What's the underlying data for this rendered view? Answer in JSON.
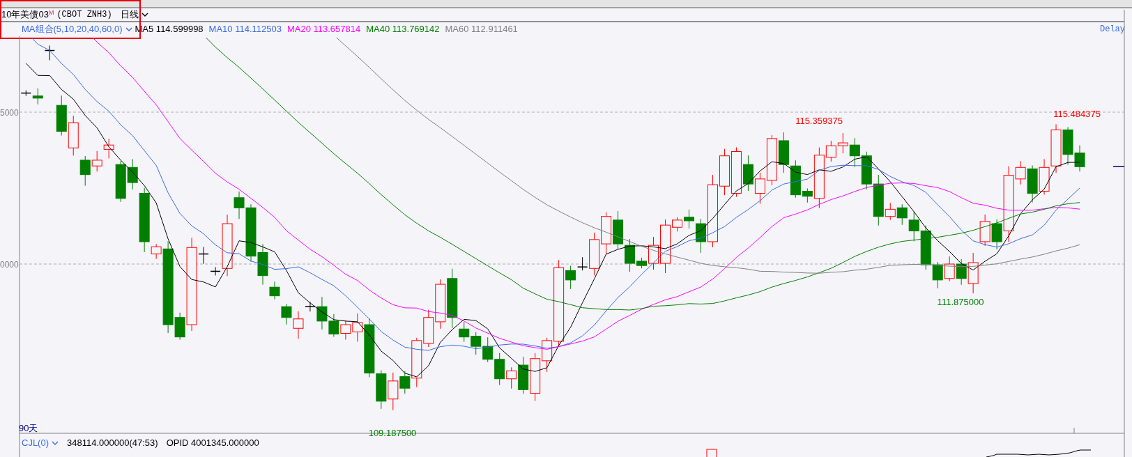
{
  "instrument": {
    "name": "10年美债03$^{M}$",
    "code": "(CBOT ZNH3)",
    "period": "日线"
  },
  "indicator": {
    "label": "MA组合(5,10,20,40,60,0)",
    "values": [
      {
        "label": "MA5 114.599998",
        "color": "#000000"
      },
      {
        "label": "MA10 114.112503",
        "color": "#3b6be0"
      },
      {
        "label": "MA20 113.657814",
        "color": "#ff00ff"
      },
      {
        "label": "MA40 113.769142",
        "color": "#008000"
      },
      {
        "label": "MA60 112.911461",
        "color": "#808080"
      }
    ]
  },
  "feed_status": "Delay",
  "y_axis_labels": [
    "5000",
    "0000"
  ],
  "price_annotations": [
    {
      "text": "115.359375",
      "kind": "high"
    },
    {
      "text": "115.484375",
      "kind": "high"
    },
    {
      "text": "111.875000",
      "kind": "low"
    },
    {
      "text": "109.187500",
      "kind": "low"
    }
  ],
  "range_label": "90天",
  "volume_pane": {
    "indicator": "CJL(0)",
    "reading": "348114.000000(47:53)",
    "opid": "OPID 4001345.000000"
  }
}
